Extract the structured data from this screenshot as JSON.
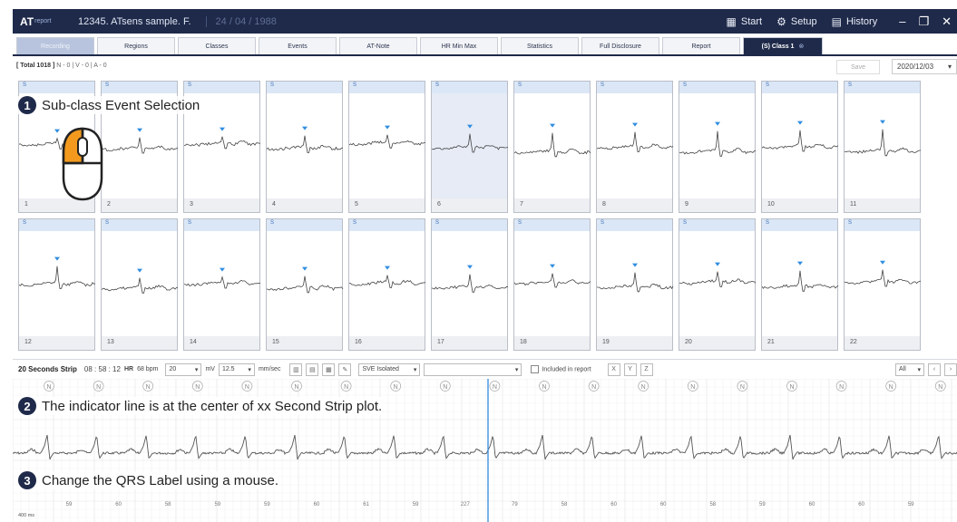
{
  "titlebar": {
    "logo": "AT",
    "logo_sub": "report",
    "patient": "12345. ATsens sample. F.",
    "dob": "24 / 04 / 1988",
    "start": "Start",
    "setup": "Setup",
    "history": "History",
    "icons": {
      "start": "grid-icon",
      "setup": "gear-icon",
      "history": "history-icon"
    }
  },
  "tabs": [
    {
      "label": "Recording"
    },
    {
      "label": "Regions"
    },
    {
      "label": "Classes"
    },
    {
      "label": "Events"
    },
    {
      "label": "AT-Note"
    },
    {
      "label": "HR Min Max"
    },
    {
      "label": "Statistics"
    },
    {
      "label": "Full Disclosure"
    },
    {
      "label": "Report"
    },
    {
      "label": "(S) Class 1"
    }
  ],
  "active_tab_close": "⊗",
  "summary": {
    "total": "[ Total 1018 ]",
    "counts": "N - 0 | V - 0 | A - 0"
  },
  "save_label": "Save",
  "date_value": "2020/12/03",
  "events": {
    "header": "S",
    "row1": [
      "1",
      "2",
      "3",
      "4",
      "5",
      "6",
      "7",
      "8",
      "9",
      "10",
      "11"
    ],
    "row2": [
      "12",
      "13",
      "14",
      "15",
      "16",
      "17",
      "18",
      "19",
      "20",
      "21",
      "22"
    ],
    "selected": "6"
  },
  "callouts": {
    "c1": {
      "n": "1",
      "text": "Sub-class Event Selection"
    },
    "c2": {
      "n": "2",
      "text": "The indicator line is at the center of xx Second Strip plot."
    },
    "c3": {
      "n": "3",
      "text": "Change the QRS Label using a mouse."
    }
  },
  "strip_bar": {
    "title": "20 Seconds Strip",
    "time": "08 : 58 : 12",
    "hr_label": "HR",
    "hr_value": "68 bpm",
    "gain": "20",
    "gain_unit": "mV",
    "speed": "12.5",
    "speed_unit": "mm/sec",
    "rhythm": "SVE Isolated",
    "rhythm2": "",
    "include_label": "Included in report",
    "filter": "All",
    "btns": [
      "X",
      "Y",
      "Z"
    ]
  },
  "strip": {
    "labels": [
      "N",
      "N",
      "N",
      "N",
      "N",
      "N",
      "N",
      "N",
      "N",
      "N",
      "N",
      "N",
      "N",
      "N",
      "N",
      "N",
      "N",
      "N",
      "N"
    ],
    "hr_values": [
      "59",
      "60",
      "58",
      "59",
      "59",
      "60",
      "61",
      "59",
      "227",
      "79",
      "58",
      "60",
      "60",
      "58",
      "59",
      "60",
      "60",
      "59"
    ],
    "scale_label": "400 ms"
  }
}
